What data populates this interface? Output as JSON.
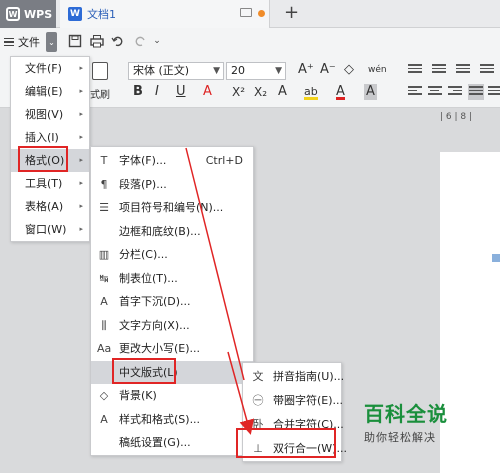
{
  "titlebar": {
    "app_tab": "WPS",
    "doc_tab": "文档1",
    "new_tab": "+"
  },
  "toolbar": {
    "menu_label": "文件",
    "drop_glyph": "⌄"
  },
  "ribbon": {
    "paste_label": "式刷",
    "font_name": "宋体 (正文)",
    "font_size": "20",
    "bold": "B",
    "italic": "I",
    "underline": "U",
    "font_color_a": "A",
    "superscript": "X²",
    "subscript": "X₂",
    "text_effect": "A",
    "highlight": "ab",
    "char_color": "A",
    "char_shade": "A",
    "grow": "A⁺",
    "shrink": "A⁻",
    "phonetic": "wén",
    "ruler_text": "| 6 |  8  |"
  },
  "menu_main": [
    {
      "label": "文件(F)",
      "sub": "▸"
    },
    {
      "label": "编辑(E)",
      "sub": "▸"
    },
    {
      "label": "视图(V)",
      "sub": "▸"
    },
    {
      "label": "插入(I)",
      "sub": "▸"
    },
    {
      "label": "格式(O)",
      "sub": "▸"
    },
    {
      "label": "工具(T)",
      "sub": "▸"
    },
    {
      "label": "表格(A)",
      "sub": "▸"
    },
    {
      "label": "窗口(W)",
      "sub": "▸"
    }
  ],
  "menu_format": [
    {
      "label": "字体(F)...",
      "shortcut": "Ctrl+D",
      "icon": "T"
    },
    {
      "label": "段落(P)...",
      "icon": "¶"
    },
    {
      "label": "项目符号和编号(N)...",
      "icon": "☰"
    },
    {
      "label": "边框和底纹(B)...",
      "icon": ""
    },
    {
      "label": "分栏(C)...",
      "icon": "▥"
    },
    {
      "label": "制表位(T)...",
      "icon": "↹"
    },
    {
      "label": "首字下沉(D)...",
      "icon": "A"
    },
    {
      "label": "文字方向(X)...",
      "icon": "⫼"
    },
    {
      "label": "更改大小写(E)...",
      "icon": "Aa"
    },
    {
      "label": "中文版式(L)",
      "sub": "▸",
      "icon": ""
    },
    {
      "label": "背景(K)",
      "sub": "▸",
      "icon": "◇"
    },
    {
      "label": "样式和格式(S)...",
      "icon": "A"
    },
    {
      "label": "稿纸设置(G)...",
      "icon": ""
    }
  ],
  "menu_chinese": [
    {
      "label": "拼音指南(U)...",
      "icon": "文"
    },
    {
      "label": "带圈字符(E)...",
      "icon": "㊀"
    },
    {
      "label": "合并字符(C)...",
      "icon": "卧"
    },
    {
      "label": "双行合一(W)...",
      "icon": "⊥"
    }
  ],
  "watermark": {
    "title": "百科全说",
    "subtitle": "助你轻松解决"
  },
  "colors": {
    "highlight_red": "#e02525",
    "menu_hover": "#d4d6da",
    "brand_green": "#1a8f3c"
  }
}
